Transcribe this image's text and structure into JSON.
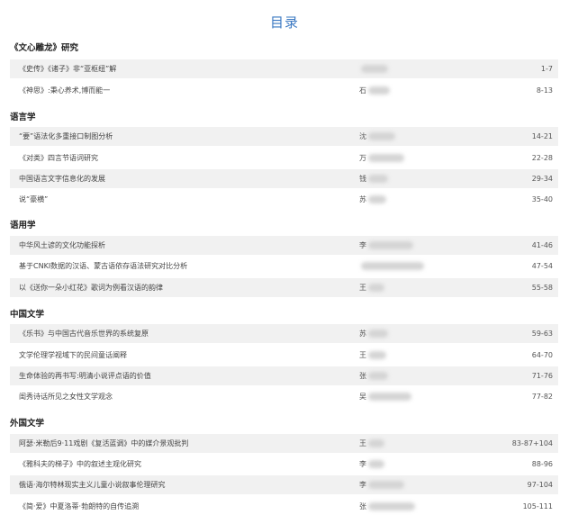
{
  "header": {
    "title": "目录"
  },
  "sections": [
    {
      "name": "《文心雕龙》研究",
      "items": [
        {
          "title": "《史传》《诸子》非“亚枢纽”解",
          "author": "",
          "pages": "1-7"
        },
        {
          "title": "《神思》:秉心养术,博而能一",
          "author": "石",
          "pages": "8-13"
        }
      ]
    },
    {
      "name": "语言学",
      "items": [
        {
          "title": "“要”语法化多重接口制图分析",
          "author": "沈",
          "pages": "14-21"
        },
        {
          "title": "《对类》四言节语词研究",
          "author": "万",
          "pages": "22-28"
        },
        {
          "title": "中国语言文字信息化的发展",
          "author": "钱",
          "pages": "29-34"
        },
        {
          "title": "说“豪横”",
          "author": "苏",
          "pages": "35-40"
        }
      ]
    },
    {
      "name": "语用学",
      "items": [
        {
          "title": "中华风土谚的文化功能探析",
          "author": "李",
          "pages": "41-46"
        },
        {
          "title": "基于CNKI数据的汉语、蒙古语依存语法研究对比分析",
          "author": "",
          "pages": "47-54"
        },
        {
          "title": "以《送你一朵小红花》歌词为例看汉语的韵律",
          "author": "王",
          "pages": "55-58"
        }
      ]
    },
    {
      "name": "中国文学",
      "items": [
        {
          "title": "《乐书》与中国古代音乐世界的系统复原",
          "author": "苏",
          "pages": "59-63"
        },
        {
          "title": "文学伦理学视域下的民间童话阐释",
          "author": "王",
          "pages": "64-70"
        },
        {
          "title": "生命体验的再书写:明清小说评点语的价值",
          "author": "张",
          "pages": "71-76"
        },
        {
          "title": "闺秀诗话所见之女性文学观念",
          "author": "吴",
          "pages": "77-82"
        }
      ]
    },
    {
      "name": "外国文学",
      "items": [
        {
          "title": "阿瑟·米勒后9·11戏剧《复活蓝调》中的媒介景观批判",
          "author": "王",
          "pages": "83-87+104"
        },
        {
          "title": "《雅科夫的梯子》中的叙述主观化研究",
          "author": "李",
          "pages": "88-96"
        },
        {
          "title": "俄语·海尔特林现实主义儿童小说叙事伦理研究",
          "author": "李",
          "pages": "97-104"
        },
        {
          "title": "《简·爱》中夏洛蒂·勃朗特的自传追溯",
          "author": "张",
          "pages": "105-111"
        }
      ]
    }
  ]
}
